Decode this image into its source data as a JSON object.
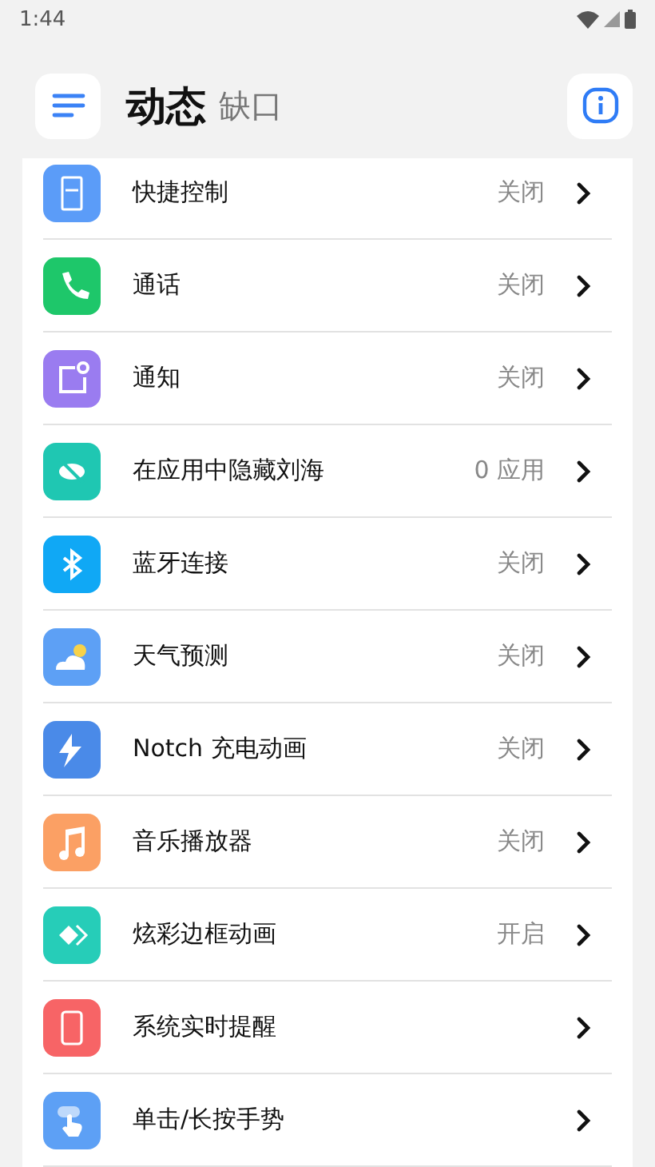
{
  "status_bar": {
    "time": "1:44"
  },
  "header": {
    "title": "动态",
    "subtitle": "缺口"
  },
  "items": [
    {
      "label": "快捷控制",
      "status": "关闭",
      "color": "#5b9cf8"
    },
    {
      "label": "通话",
      "status": "关闭",
      "color": "#1ec76a"
    },
    {
      "label": "通知",
      "status": "关闭",
      "color": "#9a7cf0"
    },
    {
      "label": "在应用中隐藏刘海",
      "status": "0 应用",
      "color": "#1fc7b2"
    },
    {
      "label": "蓝牙连接",
      "status": "关闭",
      "color": "#10a8f5"
    },
    {
      "label": "天气预测",
      "status": "关闭",
      "color": "#5da0f5"
    },
    {
      "label": "Notch 充电动画",
      "status": "关闭",
      "color": "#4a8ae8"
    },
    {
      "label": "音乐播放器",
      "status": "关闭",
      "color": "#fba064"
    },
    {
      "label": "炫彩边框动画",
      "status": "开启",
      "color": "#26cdb8"
    },
    {
      "label": "系统实时提醒",
      "color": "#f76466"
    },
    {
      "label": "单击/长按手势",
      "color": "#5da0f5"
    }
  ]
}
